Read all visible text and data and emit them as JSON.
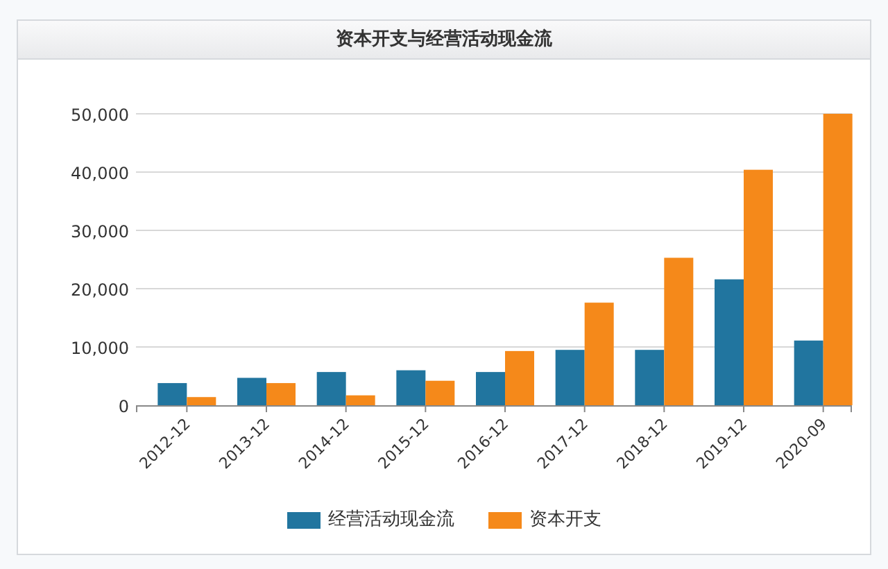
{
  "panel": {
    "title": "资本开支与经营活动现金流"
  },
  "chart_data": {
    "type": "bar",
    "categories": [
      "2012-12",
      "2013-12",
      "2014-12",
      "2015-12",
      "2016-12",
      "2017-12",
      "2018-12",
      "2019-12",
      "2020-09"
    ],
    "series": [
      {
        "name": "经营活动现金流",
        "color": "#21759f",
        "values": [
          3800,
          4700,
          5700,
          6000,
          5700,
          9500,
          9500,
          21600,
          11100
        ]
      },
      {
        "name": "资本开支",
        "color": "#f5891a",
        "values": [
          1400,
          3800,
          1700,
          4200,
          9300,
          17600,
          25300,
          40400,
          50000
        ]
      }
    ],
    "grid": true,
    "ylim": [
      0,
      50000
    ],
    "yticks": [
      {
        "value": 0,
        "label": "0"
      },
      {
        "value": 10000,
        "label": "10,000"
      },
      {
        "value": 20000,
        "label": "20,000"
      },
      {
        "value": 30000,
        "label": "30,000"
      },
      {
        "value": 40000,
        "label": "40,000"
      },
      {
        "value": 50000,
        "label": "50,000"
      }
    ]
  }
}
